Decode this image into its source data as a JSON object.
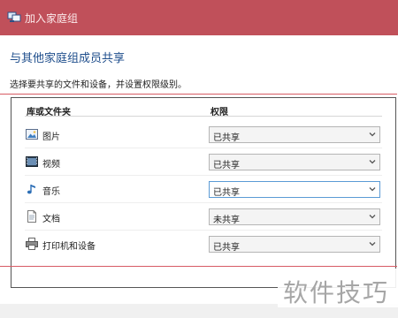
{
  "window": {
    "title": "加入家庭组",
    "title_icon": "homegroup-icon"
  },
  "heading": "与其他家庭组成员共享",
  "instruction": "选择要共享的文件和设备，并设置权限级别。",
  "columns": {
    "library": "库或文件夹",
    "permission": "权限"
  },
  "rows": [
    {
      "label": "图片",
      "icon": "pictures-icon",
      "value": "已共享"
    },
    {
      "label": "视频",
      "icon": "videos-icon",
      "value": "已共享"
    },
    {
      "label": "音乐",
      "icon": "music-icon",
      "value": "已共享"
    },
    {
      "label": "文档",
      "icon": "documents-icon",
      "value": "未共享"
    },
    {
      "label": "打印机和设备",
      "icon": "printer-icon",
      "value": "已共享"
    }
  ],
  "watermark": "软件技巧",
  "colors": {
    "titlebar": "#c0505a",
    "heading": "#1f4e8c",
    "annotation_box": "#d75b64"
  }
}
